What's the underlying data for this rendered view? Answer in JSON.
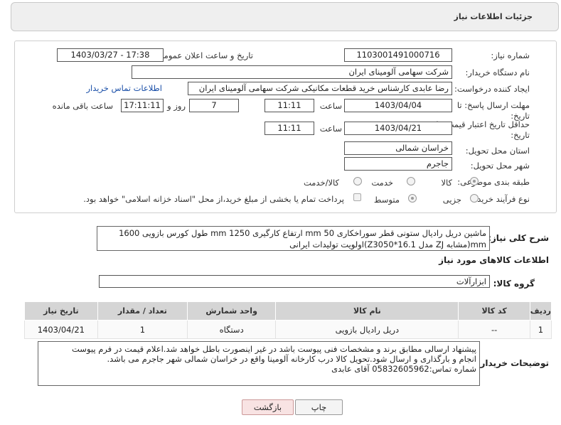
{
  "header": {
    "title": "جزئیات اطلاعات نیاز"
  },
  "form": {
    "need_number_label": "شماره نیاز:",
    "need_number": "1103001491000716",
    "announce_label": "تاریخ و ساعت اعلان عمومی:",
    "announce_value": "1403/03/27 - 17:38",
    "buyer_org_label": "نام دستگاه خریدار:",
    "buyer_org": "شرکت سهامی آلومینای ایران",
    "creator_label": "ایجاد کننده درخواست:",
    "creator": "رضا عابدی کارشناس خرید قطعات مکانیکی شرکت سهامی آلومینای ایران",
    "contact_link": "اطلاعات تماس خریدار",
    "reply_deadline_label_1": "مهلت ارسال پاسخ: تا",
    "reply_deadline_label_2": "تاریخ:",
    "reply_date": "1403/04/04",
    "time_label": "ساعت",
    "reply_time": "11:11",
    "days_value": "7",
    "days_label": "روز و",
    "remaining_time": "17:11:11",
    "remaining_label": "ساعت باقی مانده",
    "validity_label_1": "حداقل تاریخ اعتبار قیمت: تا",
    "validity_label_2": "تاریخ:",
    "validity_date": "1403/04/21",
    "validity_time": "11:11",
    "province_label": "استان محل تحویل:",
    "province": "خراسان شمالی",
    "city_label": "شهر محل تحویل:",
    "city": "جاجرم",
    "category_label": "طبقه بندی موضوعی:",
    "category_options": [
      "کالا",
      "خدمت",
      "کالا/خدمت"
    ],
    "process_label": "نوع فرآیند خرید :",
    "process_options": [
      "جزیی",
      "متوسط"
    ],
    "payment_note": "پرداخت تمام یا بخشی از مبلغ خرید،از محل \"اسناد خزانه اسلامی\" خواهد بود."
  },
  "description": {
    "label": "شرح کلی نیاز:",
    "line1": "ماشین دریل رادیال ستونی قطر سوراخکاری 50 mm ارتفاع کارگیری 1250 mm طول کورس بازویی 1600",
    "line2": "mm(مشابه ZJ  مدل 16.1*Z3050)اولویت تولیدات ایرانی"
  },
  "goods": {
    "section_title": "اطلاعات کالاهای مورد نیاز",
    "group_label": "گروه کالا:",
    "group_value": "ابزارآلات",
    "columns": [
      "ردیف",
      "کد کالا",
      "نام کالا",
      "واحد شمارش",
      "تعداد / مقدار",
      "تاریخ نیاز"
    ],
    "rows": [
      {
        "index": "1",
        "code": "--",
        "name": "دریل رادیال بازویی",
        "unit": "دستگاه",
        "qty": "1",
        "date": "1403/04/21"
      }
    ]
  },
  "buyer_notes": {
    "label": "توضیحات خریدار:",
    "line1": "پیشنهاد ارسالی مطابق برند و مشخصات فنی پیوست باشد در غیر اینصورت باطل خواهد شد.اعلام قیمت در فرم پیوست",
    "line2": "انجام و بارگذاری و ارسال شود.تحویل کالا درب کارخانه آلومینا واقع در خراسان شمالی شهر جاجرم می باشد.",
    "line3": "شماره تماس:05832605962 آقای عابدی"
  },
  "buttons": {
    "print": "چاپ",
    "back": "بازگشت"
  },
  "colors": {
    "link": "#1a4fa8",
    "header_bg": "#efefef",
    "table_header": "#d5d5d5"
  }
}
